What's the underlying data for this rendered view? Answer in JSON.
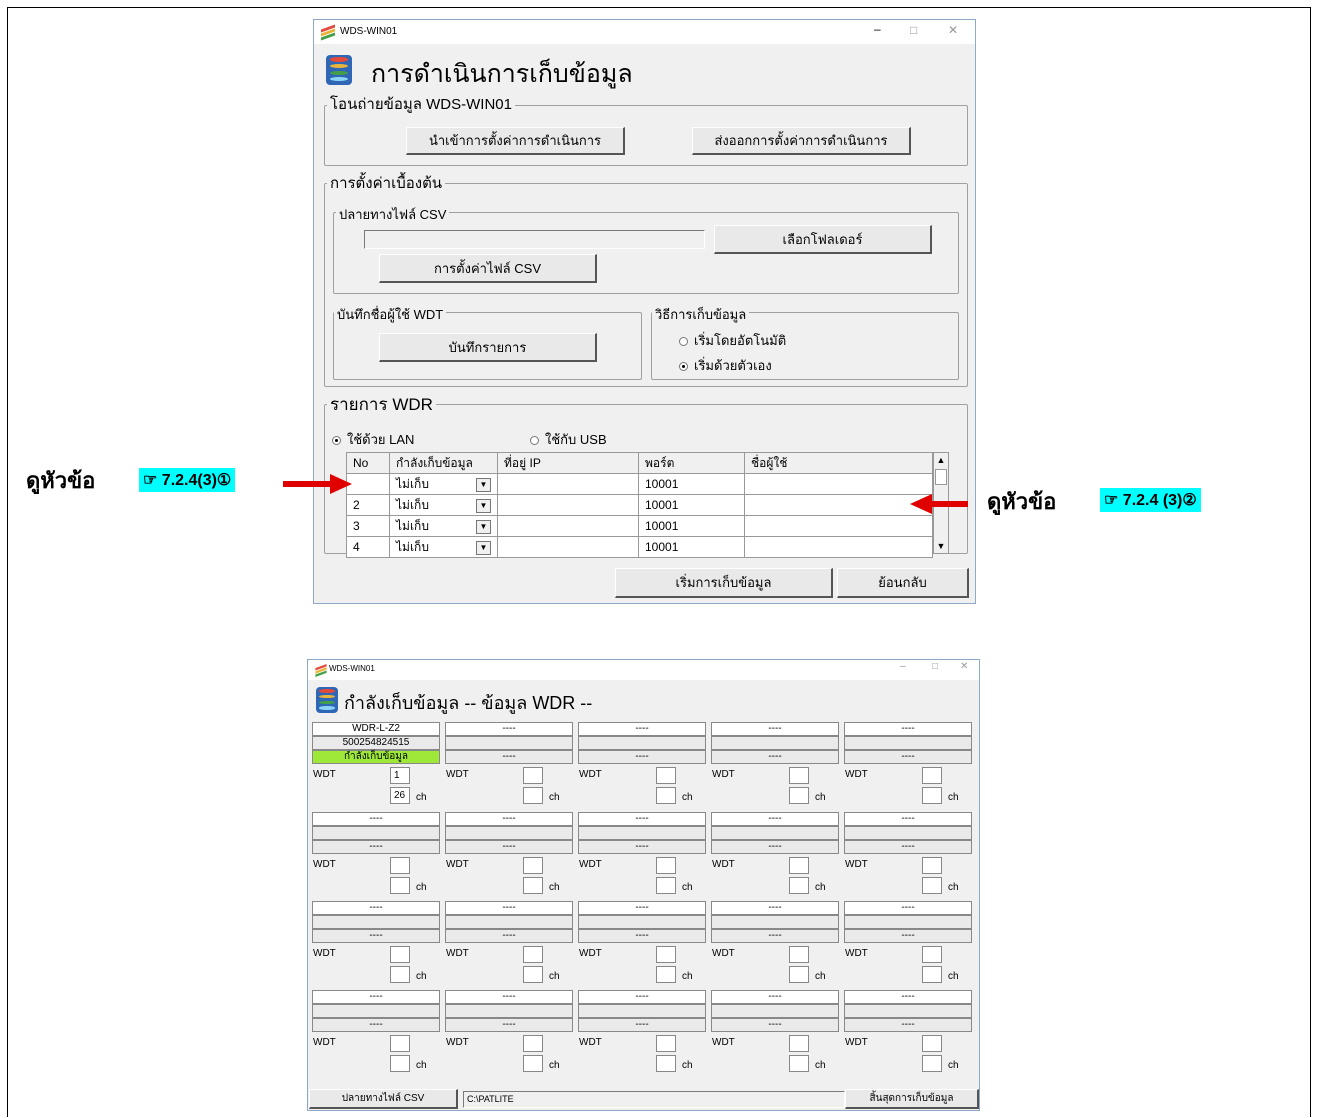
{
  "window1": {
    "title": "WDS-WIN01",
    "heading": "การดำเนินการเก็บข้อมูล",
    "transfer_group": "โอนถ่ายข้อมูล WDS-WIN01",
    "import_button": "นำเข้าการตั้งค่าการดำเนินการ",
    "export_button": "ส่งออกการตั้งค่าการดำเนินการ",
    "initial_group": "การตั้งค่าเบื้องต้น",
    "csv_dest_group": "ปลายทางไฟล์ CSV",
    "csv_path_value": "",
    "select_folder_button": "เลือกโฟลเดอร์",
    "csv_settings_button": "การตั้งค่าไฟล์ CSV",
    "wdt_names_group": "บันทึกชื่อผู้ใช้ WDT",
    "save_list_button": "บันทึกรายการ",
    "method_group": "วิธีการเก็บข้อมูล",
    "radio_auto": "เริ่มโดยอัตโนมัติ",
    "radio_manual": "เริ่มด้วยตัวเอง",
    "wdr_group": "รายการ WDR",
    "radio_lan": "ใช้ด้วย LAN",
    "radio_usb": "ใช้กับ USB",
    "table_headers": [
      "No",
      "กำลังเก็บข้อมูล",
      "ที่อยู่ IP",
      "พอร์ต",
      "ชื่อผู้ใช้"
    ],
    "table_rows": [
      {
        "no": "",
        "status": "ไม่เก็บ",
        "ip": "",
        "port": "10001",
        "name": ""
      },
      {
        "no": "2",
        "status": "ไม่เก็บ",
        "ip": "",
        "port": "10001",
        "name": ""
      },
      {
        "no": "3",
        "status": "ไม่เก็บ",
        "ip": "",
        "port": "10001",
        "name": ""
      },
      {
        "no": "4",
        "status": "ไม่เก็บ",
        "ip": "",
        "port": "10001",
        "name": ""
      }
    ],
    "start_button": "เริ่มการเก็บข้อมูล",
    "back_button": "ย้อนกลับ"
  },
  "annotations": {
    "left_text": "ดูหัวข้อ",
    "left_ref": "☞ 7.2.4(3)①",
    "right_text": "ดูหัวข้อ",
    "right_ref": "☞ 7.2.4 (3)②"
  },
  "window2": {
    "title": "WDS-WIN01",
    "heading": "กำลังเก็บข้อมูล -- ข้อมูล WDR --",
    "wdt_label": "WDT",
    "ch_label": "ch",
    "first_cell": {
      "model": "WDR-L-Z2",
      "serial": "500254824515",
      "status": "กำลังเก็บข้อมูล",
      "wdt_value": "1",
      "ch_value": "26"
    },
    "placeholder": "----",
    "csv_button": "ปลายทางไฟล์ CSV",
    "csv_path": "C:\\PATLITE",
    "end_button": "สิ้นสุดการเก็บข้อมูล"
  }
}
